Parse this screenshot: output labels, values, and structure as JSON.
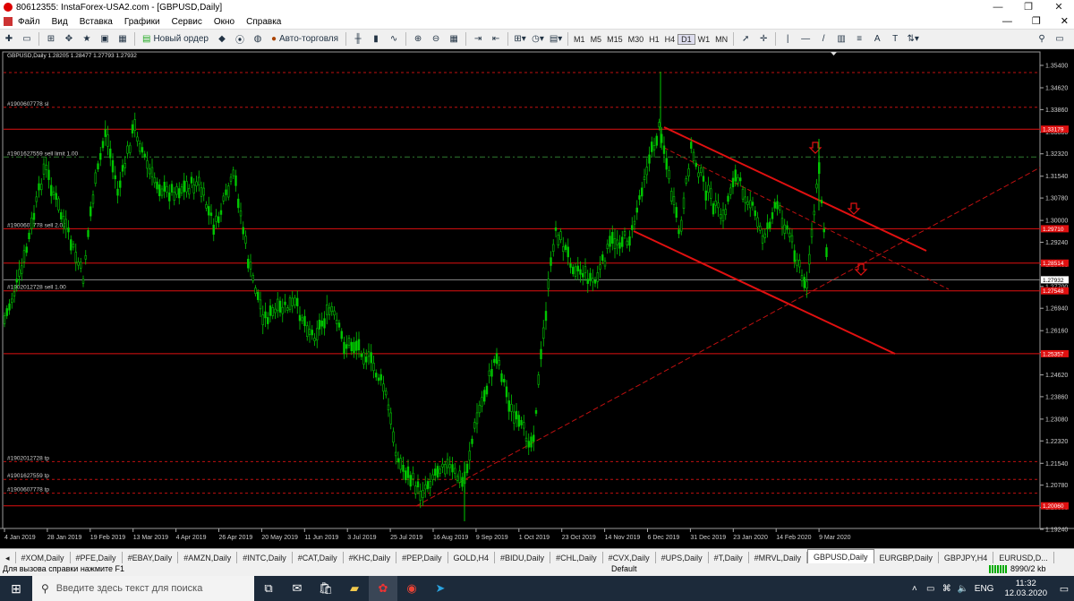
{
  "window": {
    "title": "80612355: InstaForex-USA2.com - [GBPUSD,Daily]",
    "buttons": [
      "—",
      "❐",
      "✕"
    ]
  },
  "menu": {
    "items": [
      "Файл",
      "Вид",
      "Вставка",
      "Графики",
      "Сервис",
      "Окно",
      "Справка"
    ],
    "right": [
      "—",
      "❐",
      "✕"
    ]
  },
  "toolbar": {
    "new_order": "Новый ордер",
    "auto_trading": "Авто-торговля",
    "timeframes": [
      "M1",
      "M5",
      "M15",
      "M30",
      "H1",
      "H4",
      "D1",
      "W1",
      "MN"
    ],
    "active_tf": "D1",
    "tool_glyphs": [
      "|",
      "—",
      "/",
      "▥",
      "A",
      "T"
    ]
  },
  "chart": {
    "info": "GBPUSD,Daily  1.28205 1.28477 1.27793 1.27932",
    "price_ticks": [
      "1.35400",
      "1.34620",
      "1.33860",
      "1.33080",
      "1.32320",
      "1.31540",
      "1.30780",
      "1.30000",
      "1.29240",
      "1.28460",
      "1.27700",
      "1.26940",
      "1.26160",
      "1.25400",
      "1.24620",
      "1.23860",
      "1.23080",
      "1.22320",
      "1.21540",
      "1.20780",
      "1.20000",
      "1.19240"
    ],
    "date_ticks": [
      "4 Jan 2019",
      "28 Jan 2019",
      "19 Feb 2019",
      "13 Mar 2019",
      "4 Apr 2019",
      "26 Apr 2019",
      "20 May 2019",
      "11 Jun 2019",
      "3 Jul 2019",
      "25 Jul 2019",
      "16 Aug 2019",
      "9 Sep 2019",
      "1 Oct 2019",
      "23 Oct 2019",
      "14 Nov 2019",
      "6 Dec 2019",
      "31 Dec 2019",
      "23 Jan 2020",
      "14 Feb 2020",
      "9 Mar 2020"
    ],
    "current_price": "1.27932",
    "price_boxes": [
      "1.33179",
      "1.29710",
      "1.28514",
      "1.27548",
      "1.25357",
      "1.20060"
    ],
    "order_labels": {
      "sl": "#1900607778 sl",
      "sell_limit": "#1901627559 sell limit 1.00",
      "sell_2": "#1900607778 sell 2.00",
      "sell_1": "#1902012728 sell 1.00",
      "tp1": "#1902012728 tp",
      "tp2": "#1901627559 tp",
      "tp3": "#1900607778 tp"
    },
    "colors": {
      "background": "#000000",
      "candles": "#00c800",
      "lines": "#e01010",
      "grid": "#7a7a7a"
    }
  },
  "tabs": [
    "#XOM,Daily",
    "#PFE,Daily",
    "#EBAY,Daily",
    "#AMZN,Daily",
    "#INTC,Daily",
    "#CAT,Daily",
    "#KHC,Daily",
    "#PEP,Daily",
    "GOLD,H4",
    "#BIDU,Daily",
    "#CHL,Daily",
    "#CVX,Daily",
    "#UPS,Daily",
    "#T,Daily",
    "#MRVL,Daily",
    "GBPUSD,Daily",
    "EURGBP,Daily",
    "GBPJPY,H4",
    "EURUSD,D..."
  ],
  "active_tab": "GBPUSD,Daily",
  "status": {
    "help": "Для вызова справки нажмите F1",
    "profile": "Default",
    "traffic": "8990/2 kb"
  },
  "taskbar": {
    "search_placeholder": "Введите здесь текст для поиска",
    "lang": "ENG",
    "time": "11:32",
    "date": "12.03.2020"
  }
}
